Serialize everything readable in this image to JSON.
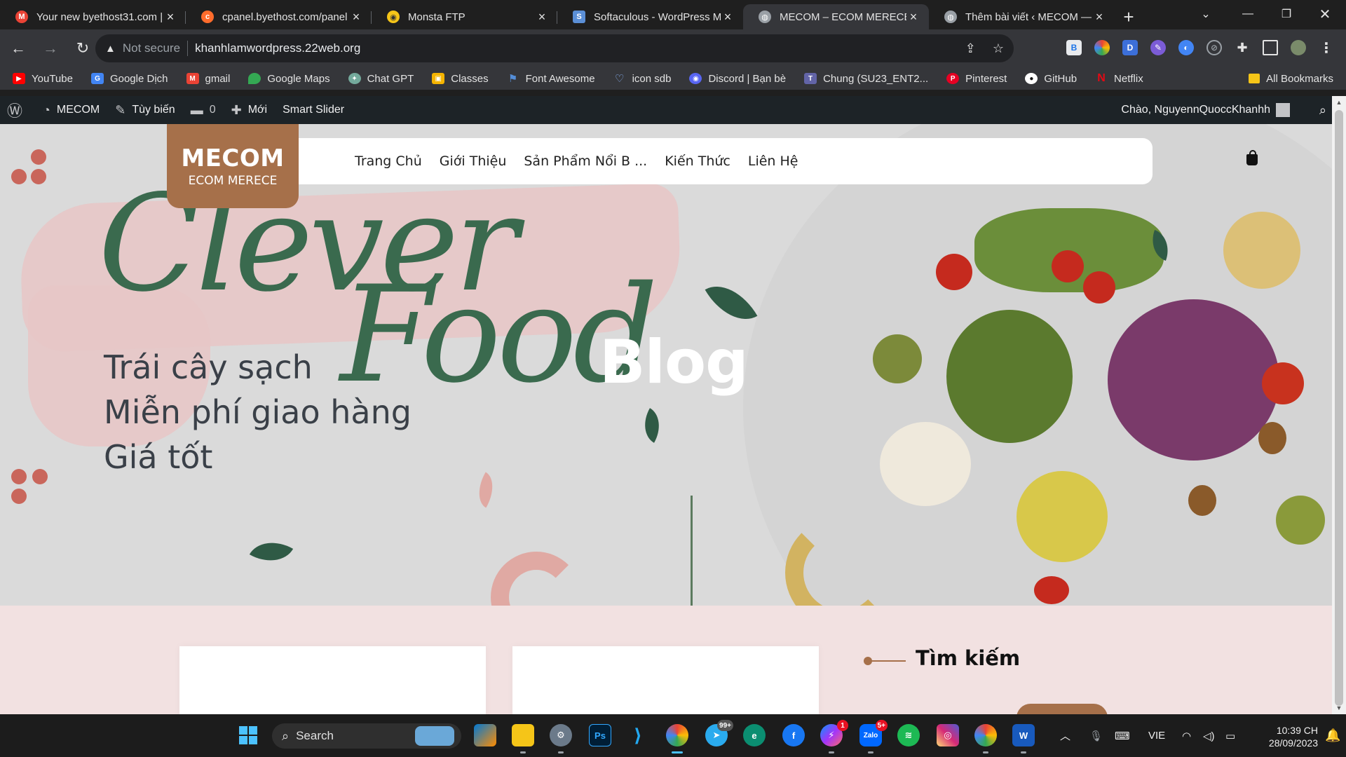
{
  "tabs": [
    {
      "title": "Your new byethost31.com |",
      "icon": "gmail-icon",
      "color": "#ea4335"
    },
    {
      "title": "cpanel.byethost.com/panel",
      "icon": "cpanel-icon",
      "color": "#ff6c2c"
    },
    {
      "title": "Monsta FTP",
      "icon": "monsta-icon",
      "color": "#f5c518"
    },
    {
      "title": "Softaculous - WordPress M",
      "icon": "softaculous-icon",
      "color": "#5b8fd6"
    },
    {
      "title": "MECOM – ECOM MERECE",
      "icon": "globe-icon",
      "color": "#9aa0a6"
    },
    {
      "title": "Thêm bài viết ‹ MECOM —",
      "icon": "globe-icon",
      "color": "#9aa0a6"
    }
  ],
  "address": {
    "security": "Not secure",
    "url": "khanhlamwordpress.22web.org"
  },
  "bookmarks": [
    {
      "label": "YouTube",
      "icon": "youtube-icon",
      "color": "#ff0000"
    },
    {
      "label": "Google Dịch",
      "icon": "translate-icon",
      "color": "#4285f4"
    },
    {
      "label": "gmail",
      "icon": "gmail-icon",
      "color": "#ea4335"
    },
    {
      "label": "Google Maps",
      "icon": "maps-icon",
      "color": "#34a853"
    },
    {
      "label": "Chat GPT",
      "icon": "chatgpt-icon",
      "color": "#74aa9c"
    },
    {
      "label": "Classes",
      "icon": "classroom-icon",
      "color": "#f5b400"
    },
    {
      "label": "Font Awesome",
      "icon": "flag-icon",
      "color": "#538dd7"
    },
    {
      "label": "icon sdb",
      "icon": "heart-icon",
      "color": "#8ab4f8"
    },
    {
      "label": "Discord | Bạn bè",
      "icon": "discord-icon",
      "color": "#5865f2"
    },
    {
      "label": "Chung (SU23_ENT2...",
      "icon": "teams-icon",
      "color": "#6264a7"
    },
    {
      "label": "Pinterest",
      "icon": "pinterest-icon",
      "color": "#e60023"
    },
    {
      "label": "GitHub",
      "icon": "github-icon",
      "color": "#ffffff"
    },
    {
      "label": "Netflix",
      "icon": "netflix-icon",
      "color": "#e50914"
    }
  ],
  "all_bookmarks": "All Bookmarks",
  "wpbar": {
    "site": "MECOM",
    "customize": "Tùy biến",
    "comments": "0",
    "new": "Mới",
    "slider": "Smart Slider",
    "greeting": "Chào, NguyennQuoccKhanhh"
  },
  "site": {
    "logo_main": "MECOM",
    "logo_sub": "ECOM MERECE",
    "nav": [
      "Trang Chủ",
      "Giới Thiệu",
      "Sản Phẩm Nổi B ...",
      "Kiến Thức",
      "Liên Hệ"
    ]
  },
  "hero": {
    "script1": "Clever",
    "script2": "Food",
    "title": "Blog",
    "lines": [
      "Trái cây sạch",
      "Miễn phí giao hàng",
      "Giá tốt"
    ]
  },
  "sidebar": {
    "widget_title": "Tìm kiếm"
  },
  "taskbar": {
    "search": "Search",
    "lang": "VIE",
    "time": "10:39 CH",
    "date": "28/09/2023",
    "badge_telegram": "99+",
    "badge_messenger": "1",
    "badge_zalo": "5+"
  },
  "colors": {
    "brand": "#a6704a",
    "green": "#3a6a4e",
    "pink": "#f2e1e1"
  }
}
